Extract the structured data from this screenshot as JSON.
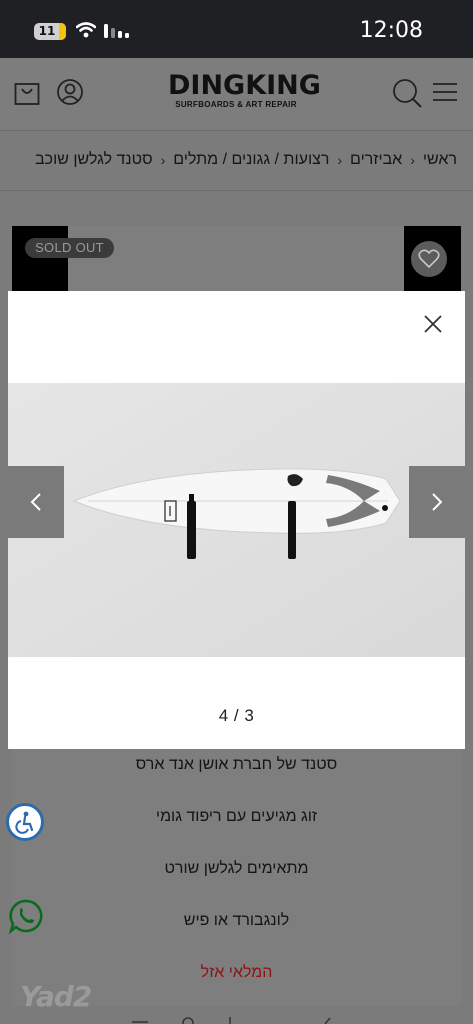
{
  "status_bar": {
    "time": "12:08",
    "battery": "11"
  },
  "header": {
    "logo_main": "DINGKING",
    "logo_sub": "SURFBOARDS & ART REPAIR"
  },
  "breadcrumb": {
    "items": [
      "ראשי",
      "אביזרים",
      "רצועות / גגונים / מתלים",
      "סטנד לגלשן שוכב"
    ],
    "separator": "‹"
  },
  "product": {
    "sold_out_badge": "SOLD OUT"
  },
  "features": [
    "סטנד של חברת אושן אנד ארס",
    "זוג מגיעים עם ריפוד גומי",
    "מתאימים לגלשן שורט",
    "לונגבורד או פיש"
  ],
  "stock_status": "המלאי אזל",
  "watermark": "Yad2",
  "modal": {
    "counter": "4 / 3"
  },
  "colors": {
    "overlay": "#7b7b7b",
    "status_bar": "#1f2024",
    "sold_out_text": "#8e1414"
  }
}
